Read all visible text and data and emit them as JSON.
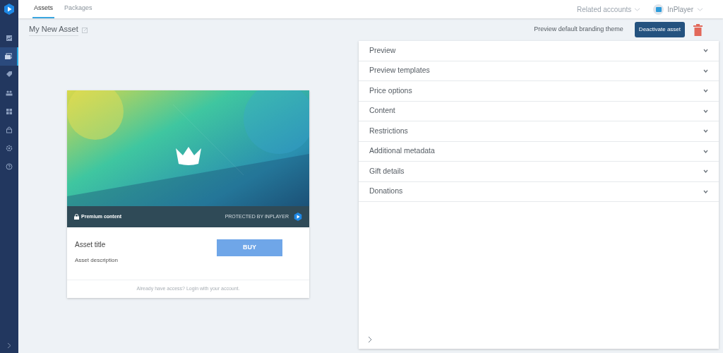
{
  "sidebar": {
    "items": [
      {
        "selected": false
      },
      {
        "selected": true
      },
      {
        "selected": false
      },
      {
        "selected": false
      },
      {
        "selected": false
      },
      {
        "selected": false
      },
      {
        "selected": false
      },
      {
        "selected": false
      }
    ]
  },
  "tabs": [
    {
      "label": "Assets",
      "selected": true
    },
    {
      "label": "Packages",
      "selected": false
    }
  ],
  "header": {
    "related_accounts": "Related accounts",
    "account": "InPlayer"
  },
  "toolbar": {
    "asset_name": "My New Asset",
    "preview_theme": "Preview default branding theme",
    "tooltip": "Deactivate asset"
  },
  "preview": {
    "badge": "Premium content",
    "protected": "PROTECTED BY INPLAYER",
    "title": "Asset title",
    "description": "Asset description",
    "buy": "BUY",
    "login": "Already have access? Login with your account."
  },
  "sections": [
    {
      "label": "Preview",
      "expanded": false
    },
    {
      "label": "Preview templates",
      "expanded": false
    },
    {
      "label": "Price options",
      "expanded": false
    },
    {
      "label": "Content",
      "expanded": false
    },
    {
      "label": "Restrictions",
      "expanded": false
    },
    {
      "label": "Additional metadata",
      "expanded": false
    },
    {
      "label": "Gift details",
      "expanded": false
    },
    {
      "label": "Donations",
      "expanded": false
    }
  ]
}
